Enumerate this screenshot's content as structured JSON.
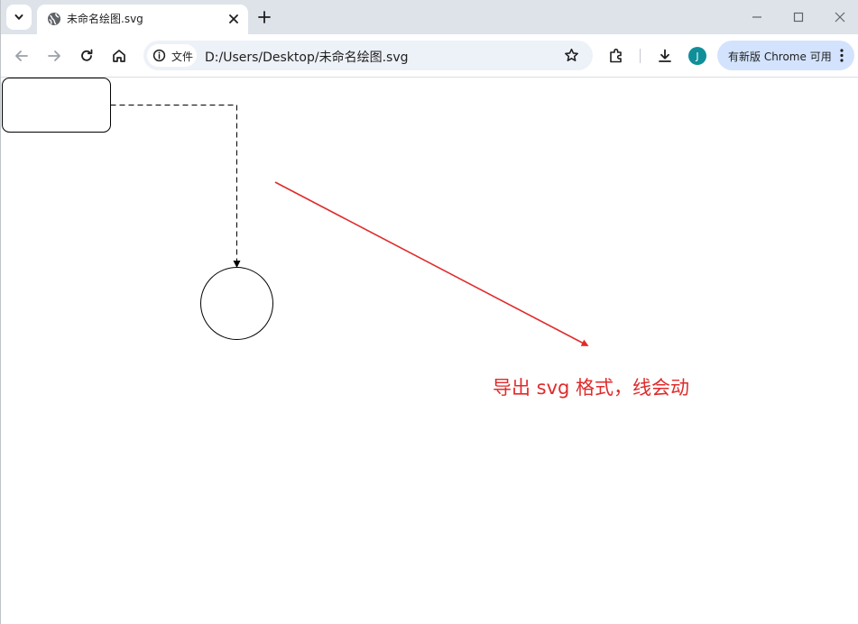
{
  "tab": {
    "title": "未命名绘图.svg"
  },
  "toolbar": {
    "site_chip_label": "文件",
    "url": "D:/Users/Desktop/未命名绘图.svg",
    "avatar_letter": "J",
    "update_label": "有新版 Chrome 可用"
  },
  "page": {
    "annotation": "导出 svg 格式，线会动",
    "annotation_color": "#e02b2b"
  },
  "icons": {
    "tab_search": "chevron-down-icon",
    "favicon": "globe-icon",
    "close": "close-icon",
    "new_tab": "plus-icon",
    "back": "back-arrow-icon",
    "forward": "forward-arrow-icon",
    "reload": "reload-icon",
    "home": "home-icon",
    "info": "info-icon",
    "bookmark": "star-icon",
    "extensions": "puzzle-icon",
    "downloads": "download-icon",
    "menu": "kebab-icon"
  }
}
